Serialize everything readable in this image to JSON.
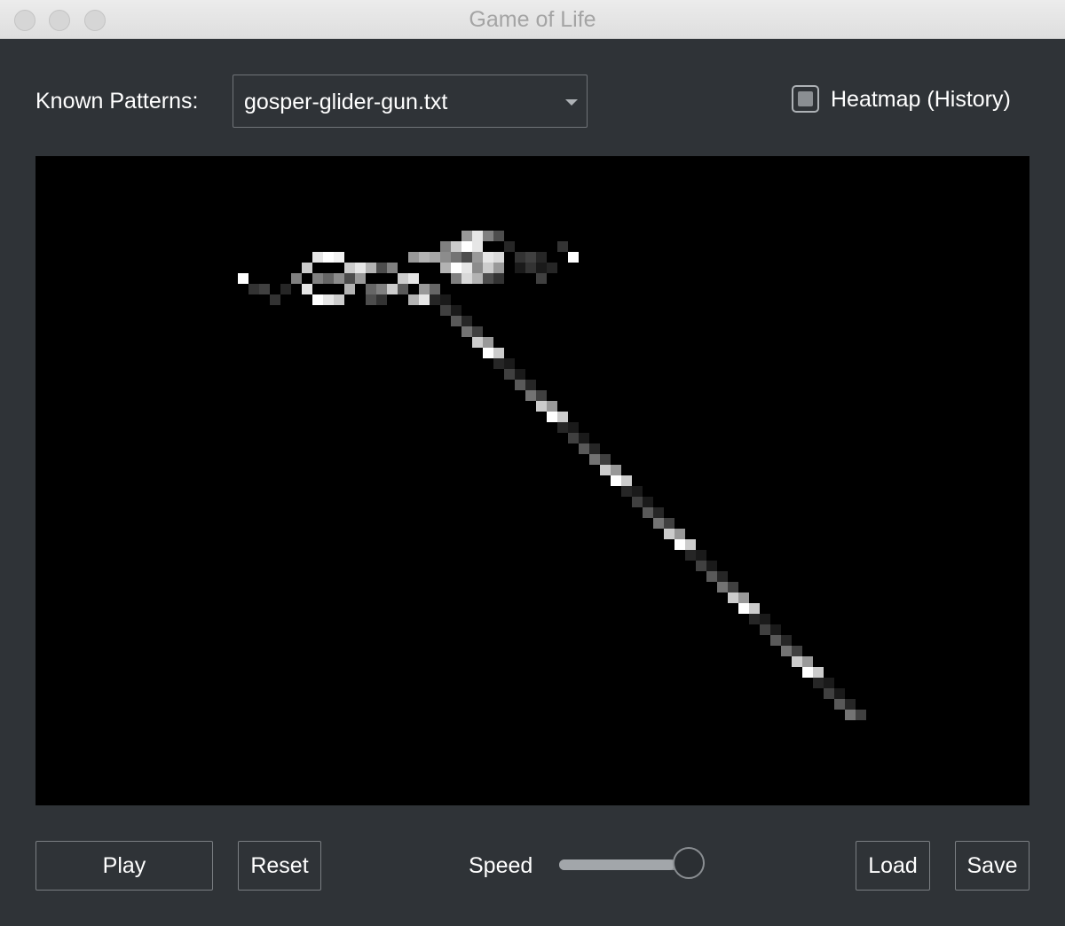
{
  "window": {
    "title": "Game of Life"
  },
  "patterns": {
    "label": "Known Patterns:",
    "selected": "gosper-glider-gun.txt"
  },
  "heatmap": {
    "label": "Heatmap (History)",
    "checked": true
  },
  "controls": {
    "play_label": "Play",
    "reset_label": "Reset",
    "speed_label": "Speed",
    "speed_value": 0.9,
    "load_label": "Load",
    "save_label": "Save"
  }
}
